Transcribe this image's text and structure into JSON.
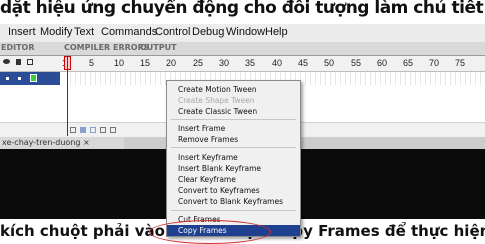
{
  "top_overlay": "dặt hiệu ứng chuyển động cho đối tượng làm chủ tiết",
  "menubar": [
    "Insert",
    "Modify",
    "Text",
    "Commands",
    "Control",
    "Debug",
    "Window",
    "Help"
  ],
  "panel_tabs": [
    "EDITOR",
    "COMPILER ERRORS",
    "OUTPUT"
  ],
  "frame_numbers": [
    "1",
    "5",
    "10",
    "15",
    "20",
    "25",
    "30",
    "35",
    "40",
    "45",
    "50",
    "55",
    "60",
    "65",
    "70",
    "75"
  ],
  "document_tab": "xe-chay-tren-duong ×",
  "context_menu": {
    "items": [
      {
        "label": "Create Motion Tween",
        "disabled": false,
        "highlight": false
      },
      {
        "label": "Create Shape Tween",
        "disabled": true,
        "highlight": false
      },
      {
        "label": "Create Classic Tween",
        "disabled": false,
        "highlight": false
      },
      {
        "label": "Insert Frame",
        "disabled": false,
        "highlight": false
      },
      {
        "label": "Remove Frames",
        "disabled": false,
        "highlight": false
      },
      {
        "label": "Insert Keyframe",
        "disabled": false,
        "highlight": false
      },
      {
        "label": "Insert Blank Keyframe",
        "disabled": false,
        "highlight": false
      },
      {
        "label": "Clear Keyframe",
        "disabled": false,
        "highlight": false
      },
      {
        "label": "Convert to Keyframes",
        "disabled": false,
        "highlight": false
      },
      {
        "label": "Convert to Blank Keyframes",
        "disabled": false,
        "highlight": false
      },
      {
        "label": "Cut Frames",
        "disabled": false,
        "highlight": false
      },
      {
        "label": "Copy Frames",
        "disabled": false,
        "highlight": true
      }
    ]
  },
  "bottom_overlay": "kích chuột phải vào frame chọn Copy Frames để thực hiện",
  "colors": {
    "highlight": "#1f3f8f",
    "playhead": "#cc0000",
    "layer": "#2b4d97",
    "annotation": "#d03030"
  }
}
